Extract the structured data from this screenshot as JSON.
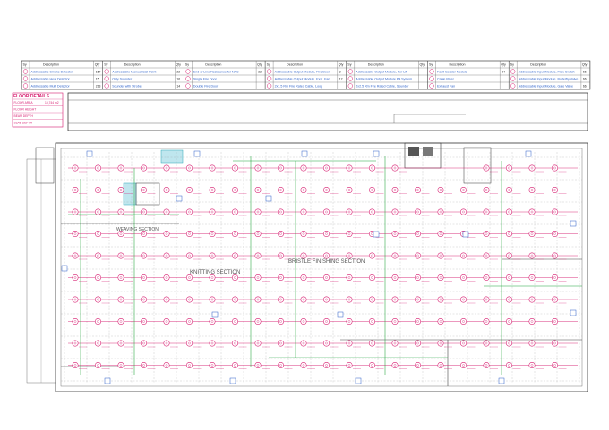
{
  "legend": {
    "headers": {
      "qty": "Qty",
      "sy": "Sy",
      "description": "Description"
    },
    "columns": [
      {
        "items": [
          {
            "description": "Addressable Smoke Detector",
            "qty": "157"
          },
          {
            "description": "Addressable Heat Detector",
            "qty": "15"
          },
          {
            "description": "Addressable Multi Detector",
            "qty": "213"
          }
        ]
      },
      {
        "items": [
          {
            "description": "Addressable Manual Call Point",
            "qty": "22"
          },
          {
            "description": "Only Sounder",
            "qty": "16"
          },
          {
            "description": "Sounder with Strobe",
            "qty": "14"
          }
        ]
      },
      {
        "items": [
          {
            "description": "End of Line Resistance for NAC",
            "qty": "32"
          },
          {
            "description": "Single Fire Door",
            "qty": ""
          },
          {
            "description": "Double Fire Door",
            "qty": ""
          }
        ]
      },
      {
        "items": [
          {
            "description": "Addressable Output Module, Fire Door",
            "qty": "2"
          },
          {
            "description": "Addressable Output Module, Exst. Fan",
            "qty": "12"
          },
          {
            "description": "2x1.5 Rm Fire Rated Cable, Loop",
            "qty": ""
          }
        ]
      },
      {
        "items": [
          {
            "description": "Addressable Output Module, For Lift",
            "qty": ""
          },
          {
            "description": "Addressable Output Module,PA System",
            "qty": ""
          },
          {
            "description": "2x2.5 Rm Fire Rated Cable, Sounder",
            "qty": ""
          }
        ]
      },
      {
        "items": [
          {
            "description": "Fault Isolator Module",
            "qty": "24"
          },
          {
            "description": "Cable Riser",
            "qty": ""
          },
          {
            "description": "Exhaust Fan",
            "qty": ""
          }
        ]
      },
      {
        "items": [
          {
            "description": "Addressable Input Module, Flow Switch",
            "qty": "66"
          },
          {
            "description": "Addressable Input Module, Butterfly Valve",
            "qty": "66"
          },
          {
            "description": "Addressable Input Module, Gate Valve",
            "qty": "66"
          }
        ]
      }
    ]
  },
  "floor_details": {
    "title": "FLOOR DETAILS",
    "rows": [
      {
        "label": "FLOOR AREA",
        "value": "10,744 m2"
      },
      {
        "label": "FLOOR HEIGHT",
        "value": ""
      },
      {
        "label": "BEAM DEPTH",
        "value": ""
      },
      {
        "label": "SLAB DEPTH",
        "value": ""
      }
    ]
  },
  "sections": {
    "weaving": "WEAVING SECTION",
    "knitting": "KNITTING SECTION",
    "bristle": "BRISTLE FINISHING SECTION"
  },
  "colors": {
    "device": "#d61a6e",
    "loop": "#1fa33a",
    "wall": "#333333",
    "accent": "#2a5fc8",
    "hatch": "#2aa8b8"
  },
  "icons": [
    "smoke-detector-icon",
    "heat-detector-icon",
    "multi-detector-icon",
    "manual-call-point-icon",
    "sounder-icon",
    "strobe-icon",
    "eol-resistor-icon",
    "fire-door-icon",
    "output-module-icon",
    "fault-isolator-icon",
    "cable-riser-icon",
    "exhaust-fan-icon",
    "input-module-icon"
  ]
}
